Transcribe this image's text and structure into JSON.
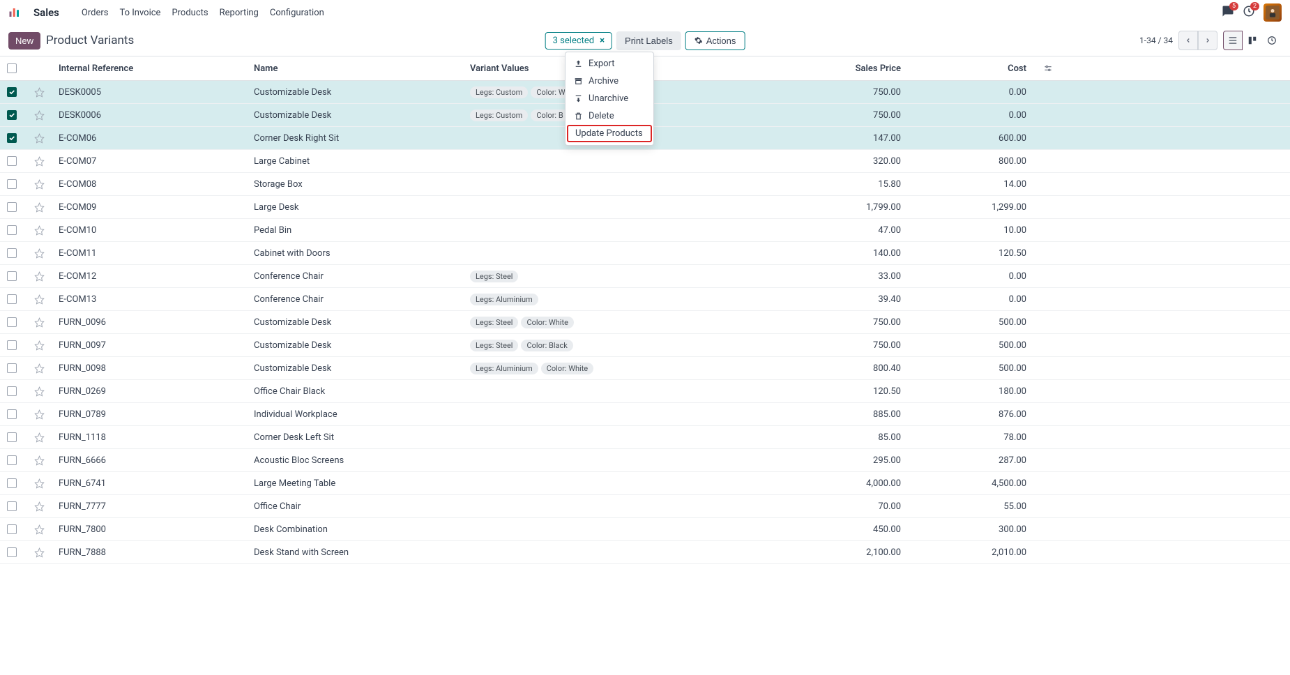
{
  "nav": {
    "app": "Sales",
    "items": [
      "Orders",
      "To Invoice",
      "Products",
      "Reporting",
      "Configuration"
    ],
    "chat_badge": "5",
    "clock_badge": "2"
  },
  "controls": {
    "new_btn": "New",
    "title": "Product Variants",
    "selected_chip": "3 selected",
    "print_labels": "Print Labels",
    "actions": "Actions",
    "pager": "1-34 / 34"
  },
  "dropdown": {
    "export": "Export",
    "archive": "Archive",
    "unarchive": "Unarchive",
    "delete": "Delete",
    "update": "Update Products"
  },
  "columns": {
    "ref": "Internal Reference",
    "name": "Name",
    "variants": "Variant Values",
    "price": "Sales Price",
    "cost": "Cost"
  },
  "rows": [
    {
      "checked": true,
      "ref": "DESK0005",
      "name": "Customizable Desk",
      "tags": [
        "Legs: Custom",
        "Color: W"
      ],
      "price": "750.00",
      "cost": "0.00"
    },
    {
      "checked": true,
      "ref": "DESK0006",
      "name": "Customizable Desk",
      "tags": [
        "Legs: Custom",
        "Color: B"
      ],
      "price": "750.00",
      "cost": "0.00"
    },
    {
      "checked": true,
      "ref": "E-COM06",
      "name": "Corner Desk Right Sit",
      "tags": [],
      "price": "147.00",
      "cost": "600.00"
    },
    {
      "checked": false,
      "ref": "E-COM07",
      "name": "Large Cabinet",
      "tags": [],
      "price": "320.00",
      "cost": "800.00"
    },
    {
      "checked": false,
      "ref": "E-COM08",
      "name": "Storage Box",
      "tags": [],
      "price": "15.80",
      "cost": "14.00"
    },
    {
      "checked": false,
      "ref": "E-COM09",
      "name": "Large Desk",
      "tags": [],
      "price": "1,799.00",
      "cost": "1,299.00"
    },
    {
      "checked": false,
      "ref": "E-COM10",
      "name": "Pedal Bin",
      "tags": [],
      "price": "47.00",
      "cost": "10.00"
    },
    {
      "checked": false,
      "ref": "E-COM11",
      "name": "Cabinet with Doors",
      "tags": [],
      "price": "140.00",
      "cost": "120.50"
    },
    {
      "checked": false,
      "ref": "E-COM12",
      "name": "Conference Chair",
      "tags": [
        "Legs: Steel"
      ],
      "price": "33.00",
      "cost": "0.00"
    },
    {
      "checked": false,
      "ref": "E-COM13",
      "name": "Conference Chair",
      "tags": [
        "Legs: Aluminium"
      ],
      "price": "39.40",
      "cost": "0.00"
    },
    {
      "checked": false,
      "ref": "FURN_0096",
      "name": "Customizable Desk",
      "tags": [
        "Legs: Steel",
        "Color: White"
      ],
      "price": "750.00",
      "cost": "500.00"
    },
    {
      "checked": false,
      "ref": "FURN_0097",
      "name": "Customizable Desk",
      "tags": [
        "Legs: Steel",
        "Color: Black"
      ],
      "price": "750.00",
      "cost": "500.00"
    },
    {
      "checked": false,
      "ref": "FURN_0098",
      "name": "Customizable Desk",
      "tags": [
        "Legs: Aluminium",
        "Color: White"
      ],
      "price": "800.40",
      "cost": "500.00"
    },
    {
      "checked": false,
      "ref": "FURN_0269",
      "name": "Office Chair Black",
      "tags": [],
      "price": "120.50",
      "cost": "180.00"
    },
    {
      "checked": false,
      "ref": "FURN_0789",
      "name": "Individual Workplace",
      "tags": [],
      "price": "885.00",
      "cost": "876.00"
    },
    {
      "checked": false,
      "ref": "FURN_1118",
      "name": "Corner Desk Left Sit",
      "tags": [],
      "price": "85.00",
      "cost": "78.00"
    },
    {
      "checked": false,
      "ref": "FURN_6666",
      "name": "Acoustic Bloc Screens",
      "tags": [],
      "price": "295.00",
      "cost": "287.00"
    },
    {
      "checked": false,
      "ref": "FURN_6741",
      "name": "Large Meeting Table",
      "tags": [],
      "price": "4,000.00",
      "cost": "4,500.00"
    },
    {
      "checked": false,
      "ref": "FURN_7777",
      "name": "Office Chair",
      "tags": [],
      "price": "70.00",
      "cost": "55.00"
    },
    {
      "checked": false,
      "ref": "FURN_7800",
      "name": "Desk Combination",
      "tags": [],
      "price": "450.00",
      "cost": "300.00"
    },
    {
      "checked": false,
      "ref": "FURN_7888",
      "name": "Desk Stand with Screen",
      "tags": [],
      "price": "2,100.00",
      "cost": "2,010.00"
    }
  ]
}
